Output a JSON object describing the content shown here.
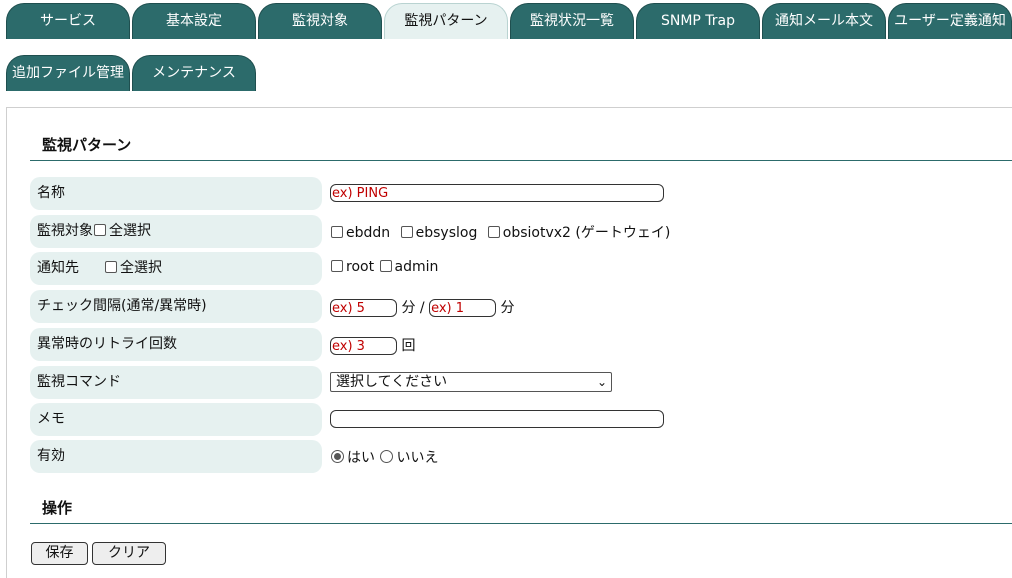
{
  "tabs": [
    {
      "label": "サービス",
      "active": false
    },
    {
      "label": "基本設定",
      "active": false
    },
    {
      "label": "監視対象",
      "active": false
    },
    {
      "label": "監視パターン",
      "active": true
    },
    {
      "label": "監視状況一覧",
      "active": false
    },
    {
      "label": "SNMP Trap",
      "active": false
    },
    {
      "label": "通知メール本文",
      "active": false
    },
    {
      "label": "ユーザー定義通知",
      "active": false
    },
    {
      "label": "追加ファイル管理",
      "active": false
    },
    {
      "label": "メンテナンス",
      "active": false
    }
  ],
  "form": {
    "title": "監視パターン",
    "name": {
      "label": "名称",
      "placeholder": "ex) PING",
      "value": ""
    },
    "targets": {
      "label": "監視対象",
      "select_all": "全選択",
      "options": [
        "ebddn",
        "ebsyslog",
        "obsiotvx2 (ゲートウェイ)"
      ]
    },
    "notify": {
      "label": "通知先",
      "select_all": "全選択",
      "options": [
        "root",
        "admin"
      ]
    },
    "interval": {
      "label": "チェック間隔(通常/異常時)",
      "normal_placeholder": "ex) 5",
      "abnormal_placeholder": "ex) 1",
      "unit": "分",
      "separator": "/"
    },
    "retry": {
      "label": "異常時のリトライ回数",
      "placeholder": "ex) 3",
      "unit": "回"
    },
    "command": {
      "label": "監視コマンド",
      "selected": "選択してください"
    },
    "memo": {
      "label": "メモ",
      "value": ""
    },
    "enabled": {
      "label": "有効",
      "yes": "はい",
      "no": "いいえ",
      "selected": "はい"
    }
  },
  "operations": {
    "title": "操作",
    "save_label": "保存",
    "clear_label": "クリア"
  }
}
